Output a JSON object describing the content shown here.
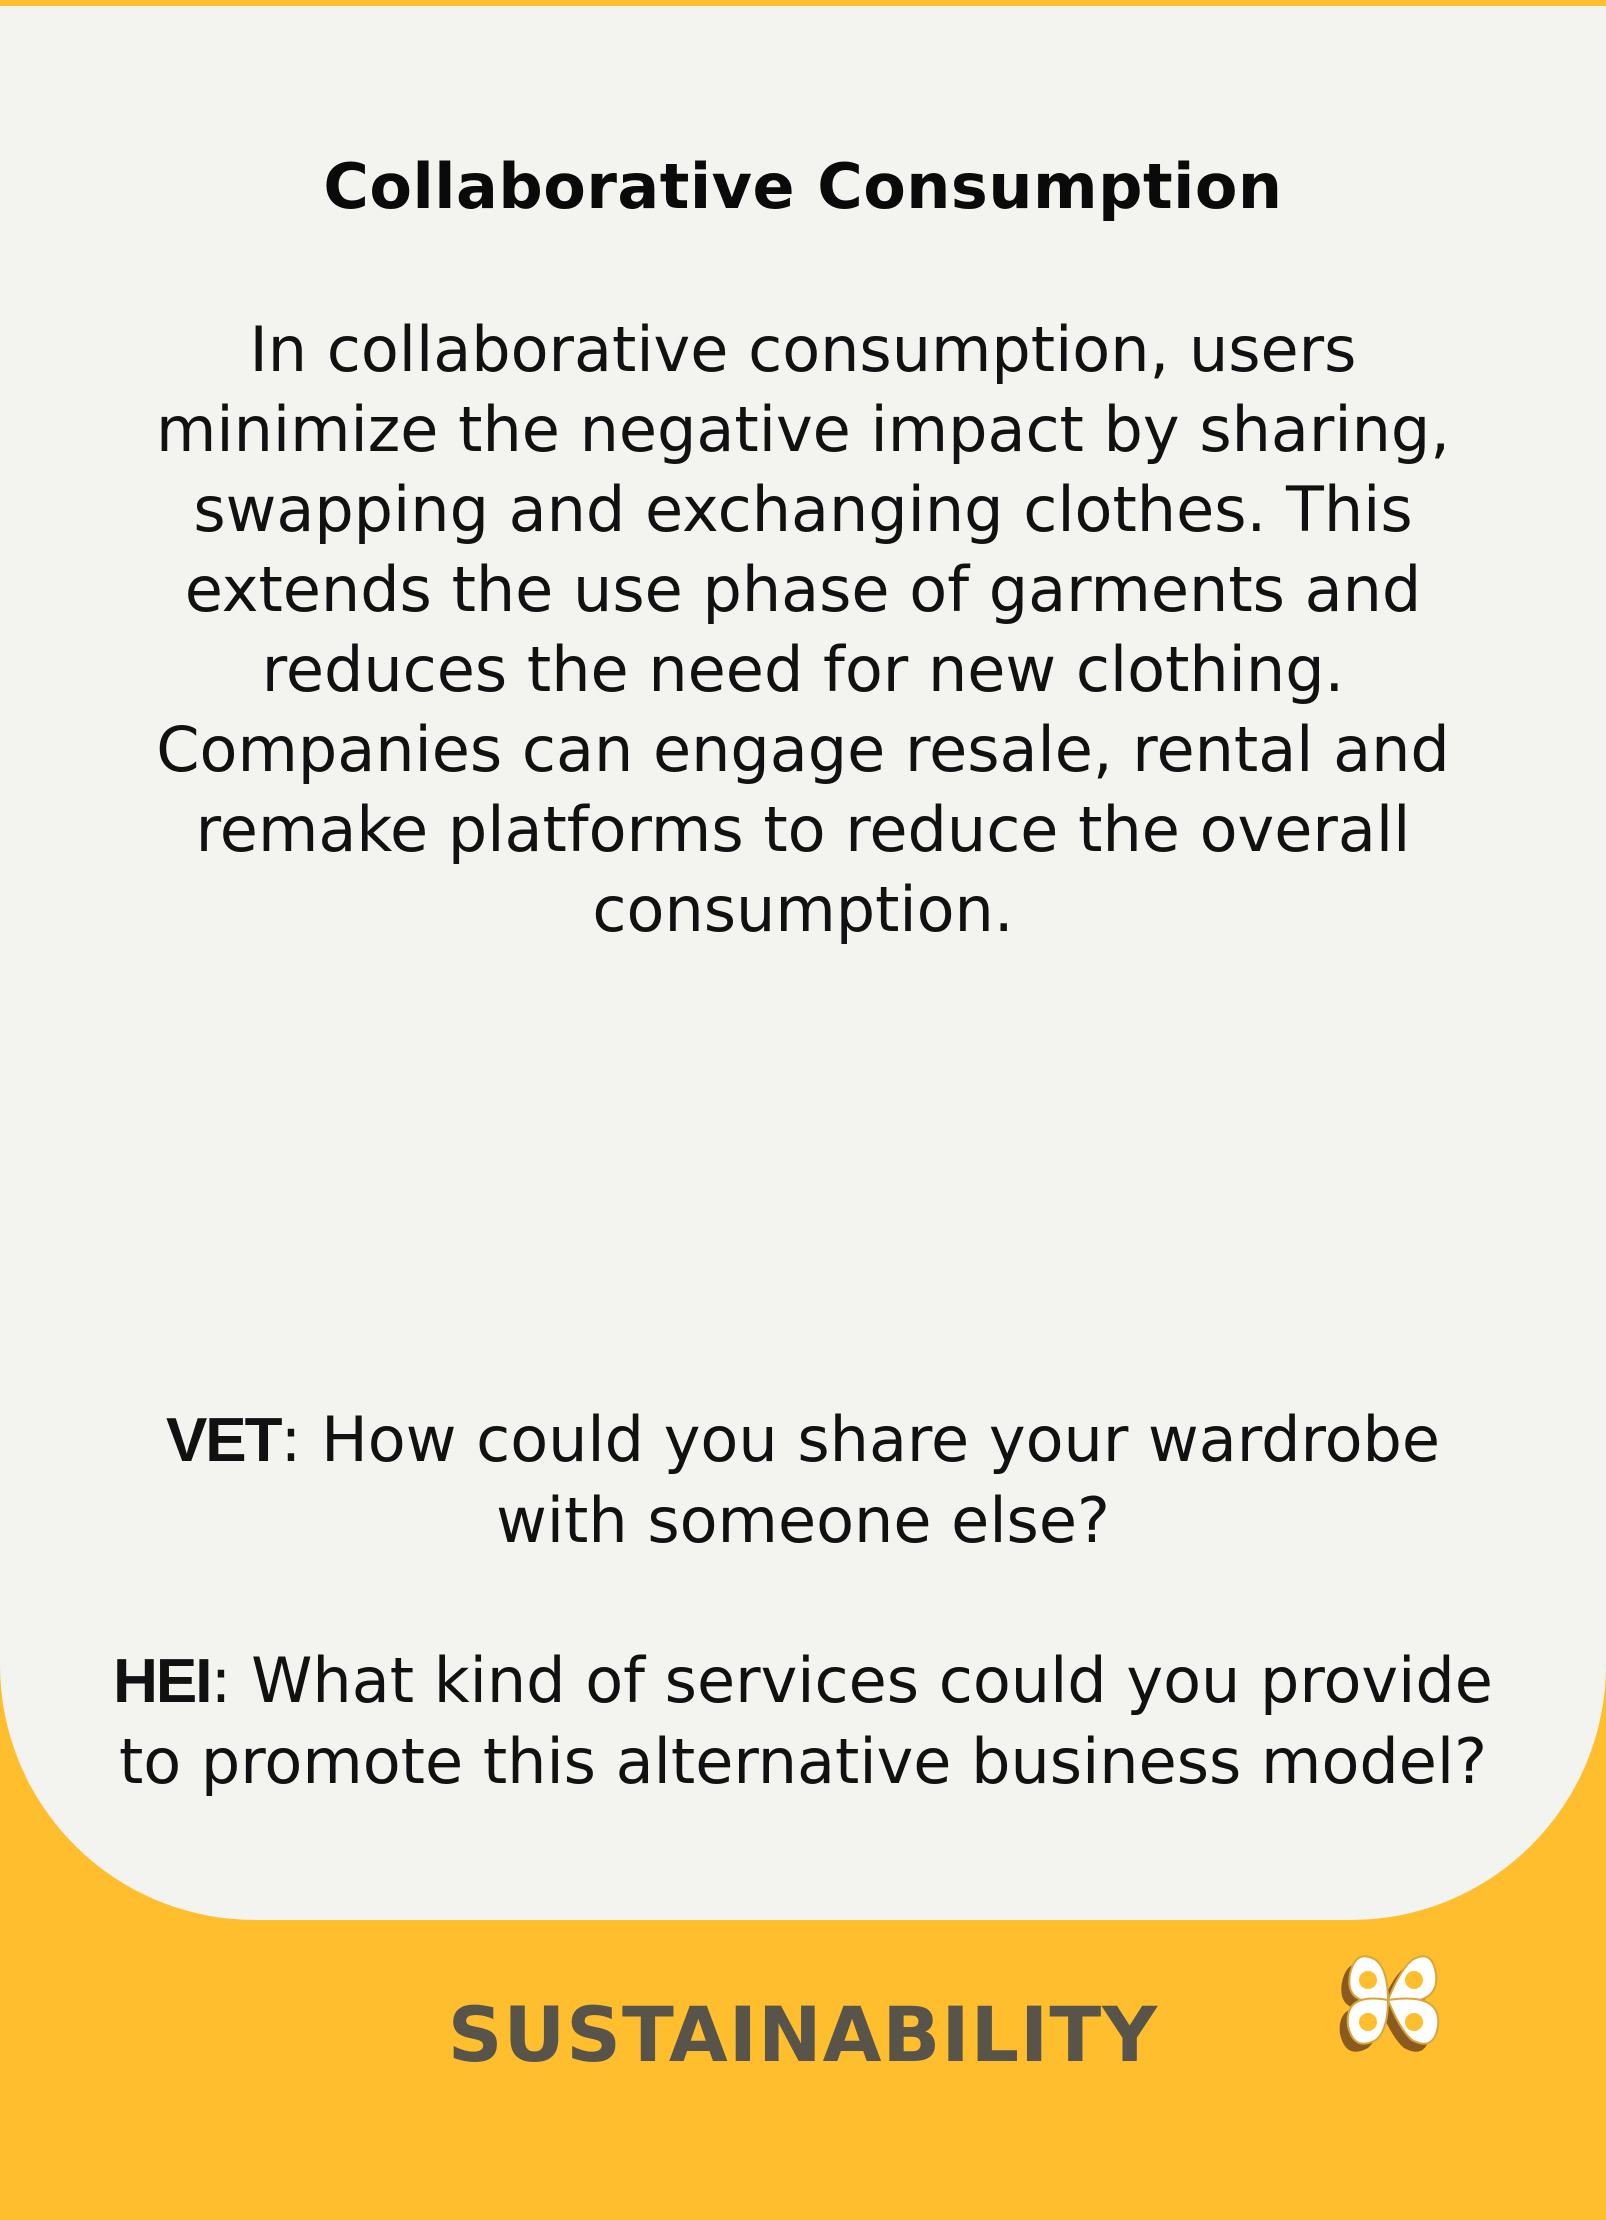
{
  "card": {
    "title": "Collaborative Consumption",
    "body": "In collaborative consumption, users minimize the negative impact by sharing, swapping and exchanging clothes. This extends the use phase of garments and reduces the need for new clothing. Companies can engage resale, rental and remake platforms to reduce the overall consumption."
  },
  "questions": [
    {
      "label": "VET",
      "separator": ": ",
      "text": "How could you share your wardrobe with someone else?"
    },
    {
      "label": "HEI",
      "separator": ": ",
      "text": "What kind of services could you provide to promote this alternative business model?"
    }
  ],
  "footer": {
    "category": "SUSTAINABILITY",
    "logo_icon": "quatrefoil-logo-icon"
  },
  "colors": {
    "accent": "#FEBE2E",
    "panel": "#F3F3EF",
    "category_text": "#58544A",
    "logo_shadow": "#8A5A1E",
    "logo_fill": "#FFFFFF"
  }
}
